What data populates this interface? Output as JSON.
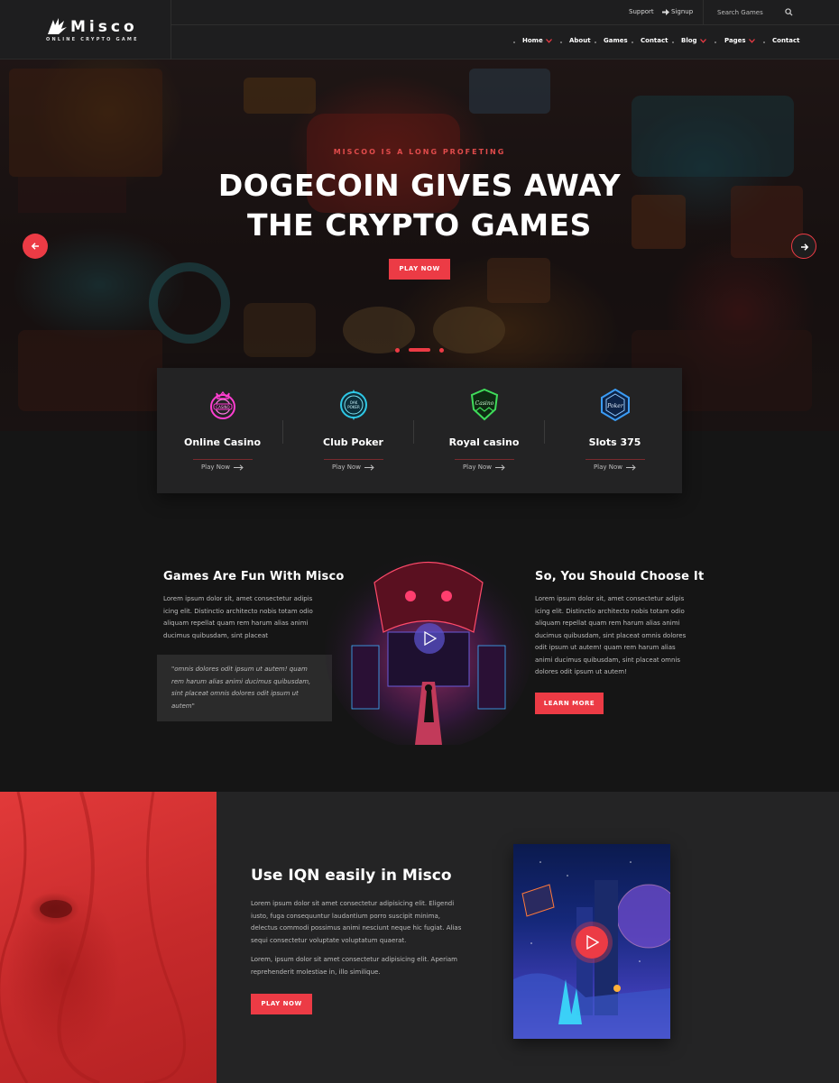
{
  "brand": {
    "name": "Misco",
    "tagline": "ONLINE CRYPTO GAME"
  },
  "topbar": {
    "support": "Support",
    "signup": "Signup",
    "search_placeholder": "Search Games"
  },
  "nav": [
    "Home",
    "About",
    "Games",
    "Contact",
    "Blog",
    "Pages",
    "Contact"
  ],
  "hero": {
    "kicker": "MISCOO IS A LONG PROFETING",
    "title_line1": "DOGECOIN GIVES AWAY",
    "title_line2": "THE CRYPTO GAMES",
    "button": "PLAY NOW"
  },
  "games": [
    {
      "title": "Online Casino",
      "link": "Play Now",
      "icon": "casino-neon-icon",
      "color": "#ff3ed1"
    },
    {
      "title": "Club Poker",
      "link": "Play Now",
      "icon": "poker-badge-icon",
      "color": "#2ec8e6"
    },
    {
      "title": "Royal casino",
      "link": "Play Now",
      "icon": "casino-shield-icon",
      "color": "#3fdc5a"
    },
    {
      "title": "Slots 375",
      "link": "Play Now",
      "icon": "poker-hexagon-icon",
      "color": "#3b9cf5"
    }
  ],
  "about": {
    "left_title": "Games Are Fun With Misco",
    "left_text": "Lorem ipsum dolor sit, amet consectetur adipis icing elit. Distinctio architecto nobis totam odio aliquam repellat quam rem harum alias animi ducimus quibusdam, sint placeat",
    "quote": "\"omnis dolores odit ipsum ut autem! quam rem harum alias animi ducimus quibusdam, sint placeat omnis dolores odit ipsum ut autem\"",
    "right_title": "So, You Should Choose It",
    "right_text": "Lorem ipsum dolor sit, amet consectetur adipis icing elit. Distinctio architecto nobis totam odio aliquam repellat quam rem harum alias animi ducimus quibusdam, sint placeat omnis dolores odit ipsum ut autem! quam rem harum alias animi ducimus quibusdam, sint placeat omnis dolores odit ipsum ut autem!",
    "button": "LEARN MORE"
  },
  "feature": {
    "title": "Use IQN easily in Misco",
    "para1": "Lorem ipsum dolor sit amet consectetur adipisicing elit. Eligendi iusto, fuga consequuntur laudantium porro suscipit minima, delectus commodi possimus animi nesciunt neque hic fugiat. Alias sequi consectetur voluptate voluptatum quaerat.",
    "para2": "Lorem, ipsum dolor sit amet consectetur adipisicing elit. Aperiam reprehenderit molestiae in, illo similique.",
    "button": "PLAY NOW"
  },
  "colors": {
    "accent": "#ec3b45",
    "bg": "#151515",
    "panel": "#232324"
  }
}
